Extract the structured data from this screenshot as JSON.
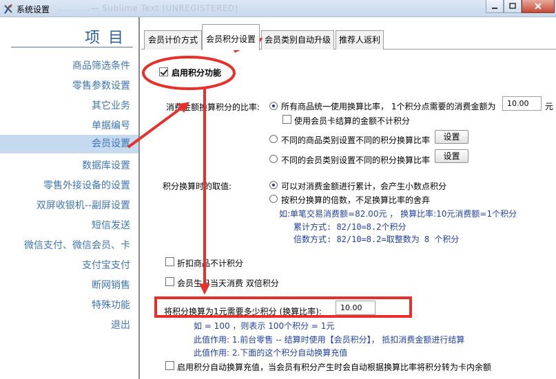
{
  "window": {
    "title": "系统设置",
    "title_blurred": "...........— Sublime Text (UNREGISTERED)"
  },
  "sidebar": {
    "header": "项目",
    "items": [
      {
        "label": "商品筛选条件"
      },
      {
        "label": "零售参数设置"
      },
      {
        "label": "其它业务"
      },
      {
        "label": "单据编号"
      },
      {
        "label": "会员设置",
        "active": true
      },
      {
        "label": "数据库设置"
      },
      {
        "label": "零售外接设备的设置"
      },
      {
        "label": "双屏收银机--副屏设置"
      },
      {
        "label": "短信发送"
      },
      {
        "label": "微信支付、微信会员、卡"
      },
      {
        "label": "支付宝支付"
      },
      {
        "label": "断网销售"
      },
      {
        "label": "特殊功能"
      },
      {
        "label": "退出"
      }
    ]
  },
  "tabs": [
    {
      "label": "会员计价方式"
    },
    {
      "label": "会员积分设置",
      "active": true
    },
    {
      "label": "会员类别自动升级"
    },
    {
      "label": "推荐人返利"
    }
  ],
  "points": {
    "enable_label": "启用积分功能",
    "enable_checked": true,
    "ratio_label": "消费金额换算积分的比率:",
    "option_uniform": "所有商品统一使用换算比率， 1个积分点需要的消费金额为",
    "uniform_value": "10.00",
    "uniform_unit": "元",
    "card_exclude_label": "使用会员卡结算的金额不计积分",
    "option_category": "不同的商品类别设置不同的积分换算比率",
    "option_member_type": "不同的会员类别设置不同的积分换算比率",
    "set_button": "设置",
    "rounding_label": "积分换算时的取值:",
    "rounding_option1": "可以对消费金额进行累计，会产生小数点积分",
    "rounding_option2": "按积分换算的倍数，不足换算比率的舍弃",
    "example_line1": "如:单笔交易消费额=82.00元 ，  换算比率:10元消费额=1个积分",
    "example_line2": "累计方式: 82/10=8.2个积分",
    "example_line3": "倍数方式: 82/10=8.2=取整数为 8 个积分",
    "discount_exclude_label": "折扣商品不计积分",
    "birthday_double_label": "会员生日当天消费 双倍积分",
    "exchange_label": "将积分换算为1元需要多少积分 (换算比率):",
    "exchange_value": "10.00",
    "exchange_note1": "如 = 100 ，则表示 100个积分 = 1元",
    "exchange_note2": "此值作用: 1.前台零售 -- 结算时使用【会员积分】， 抵扣消费金额进行结算",
    "exchange_note3": "此值作用: 2.下面的这个积分自动换算充值",
    "auto_recharge_label": "启用积分自动换算充值，当会员有积分产生时会自动根据换算比率将积分转为卡内余额"
  },
  "colors": {
    "annotation_red": "#e8302a",
    "link_blue": "#3f74b6",
    "note_blue": "#1f3fa6",
    "active_row": "#c5d9ef"
  }
}
